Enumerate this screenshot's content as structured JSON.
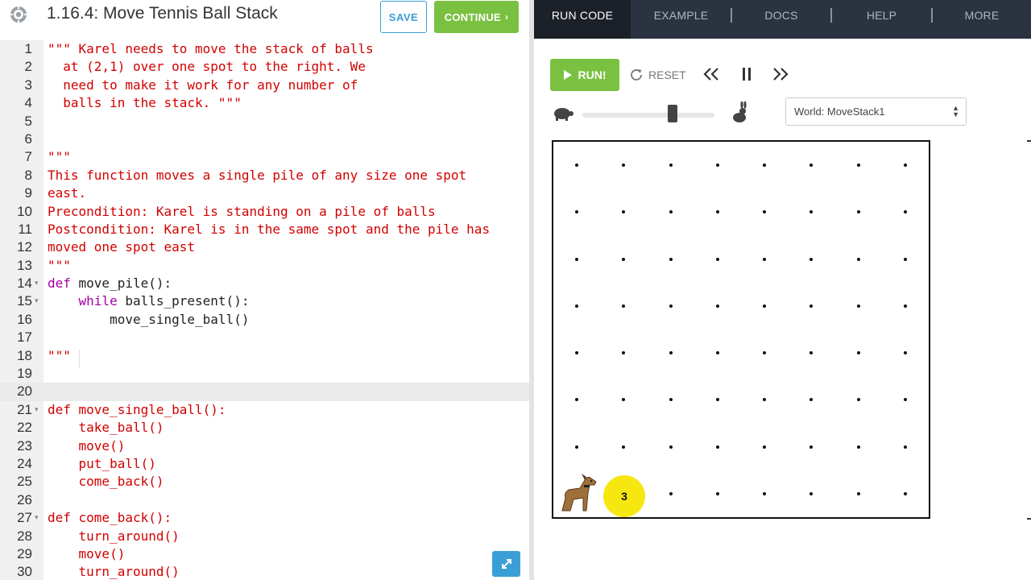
{
  "header": {
    "title": "1.16.4: Move Tennis Ball Stack",
    "save_label": "SAVE",
    "continue_label": "CONTINUE"
  },
  "editor": {
    "lines": [
      {
        "n": "1",
        "text": "\"\"\" Karel needs to move the stack of balls",
        "style": "red"
      },
      {
        "n": "2",
        "text": "  at (2,1) over one spot to the right. We",
        "style": "red"
      },
      {
        "n": "3",
        "text": "  need to make it work for any number of",
        "style": "red"
      },
      {
        "n": "4",
        "text": "  balls in the stack. \"\"\"",
        "style": "red"
      },
      {
        "n": "5",
        "text": "",
        "style": "plain"
      },
      {
        "n": "6",
        "text": "",
        "style": "plain"
      },
      {
        "n": "7",
        "text": "\"\"\"",
        "style": "red"
      },
      {
        "n": "8",
        "text": "This function moves a single pile of any size one spot",
        "style": "red"
      },
      {
        "n": "9",
        "text": "east.",
        "style": "red"
      },
      {
        "n": "10",
        "text": "Precondition: Karel is standing on a pile of balls",
        "style": "red"
      },
      {
        "n": "11",
        "text": "Postcondition: Karel is in the same spot and the pile has",
        "style": "red"
      },
      {
        "n": "12",
        "text": "moved one spot east",
        "style": "red"
      },
      {
        "n": "13",
        "text": "\"\"\"",
        "style": "red"
      },
      {
        "n": "14",
        "text": "move_pile():",
        "style": "def",
        "kw": "def ",
        "fold": true
      },
      {
        "n": "15",
        "text": "balls_present():",
        "style": "while",
        "kw": "while ",
        "fold": true
      },
      {
        "n": "16",
        "text": "        move_single_ball()",
        "style": "plain"
      },
      {
        "n": "17",
        "text": "",
        "style": "plain"
      },
      {
        "n": "18",
        "text": "\"\"\"",
        "style": "red"
      },
      {
        "n": "19",
        "text": "",
        "style": "red"
      },
      {
        "n": "20",
        "text": "",
        "style": "red"
      },
      {
        "n": "21",
        "text": "def move_single_ball():",
        "style": "red",
        "fold": true
      },
      {
        "n": "22",
        "text": "    take_ball()",
        "style": "red"
      },
      {
        "n": "23",
        "text": "    move()",
        "style": "red"
      },
      {
        "n": "24",
        "text": "    put_ball()",
        "style": "red"
      },
      {
        "n": "25",
        "text": "    come_back()",
        "style": "red"
      },
      {
        "n": "26",
        "text": "",
        "style": "red"
      },
      {
        "n": "27",
        "text": "def come_back():",
        "style": "red",
        "fold": true
      },
      {
        "n": "28",
        "text": "    turn_around()",
        "style": "red"
      },
      {
        "n": "29",
        "text": "    move()",
        "style": "red"
      },
      {
        "n": "30",
        "text": "    turn_around()",
        "style": "red"
      }
    ]
  },
  "nav": {
    "tabs": [
      "RUN CODE",
      "EXAMPLE",
      "DOCS",
      "HELP",
      "MORE"
    ]
  },
  "controls": {
    "run_label": "RUN!",
    "reset_label": "RESET",
    "speed_level": 0.68
  },
  "world": {
    "select_value": "World: MoveStack1",
    "ball_count": "3",
    "columns": 8,
    "rows": 8
  },
  "colors": {
    "accent_green": "#7ac142",
    "accent_blue": "#3a9fd6",
    "nav_bg": "#2b3340",
    "ball": "#f5e70f",
    "code_red": "#d20000",
    "keyword": "#a100a0"
  }
}
